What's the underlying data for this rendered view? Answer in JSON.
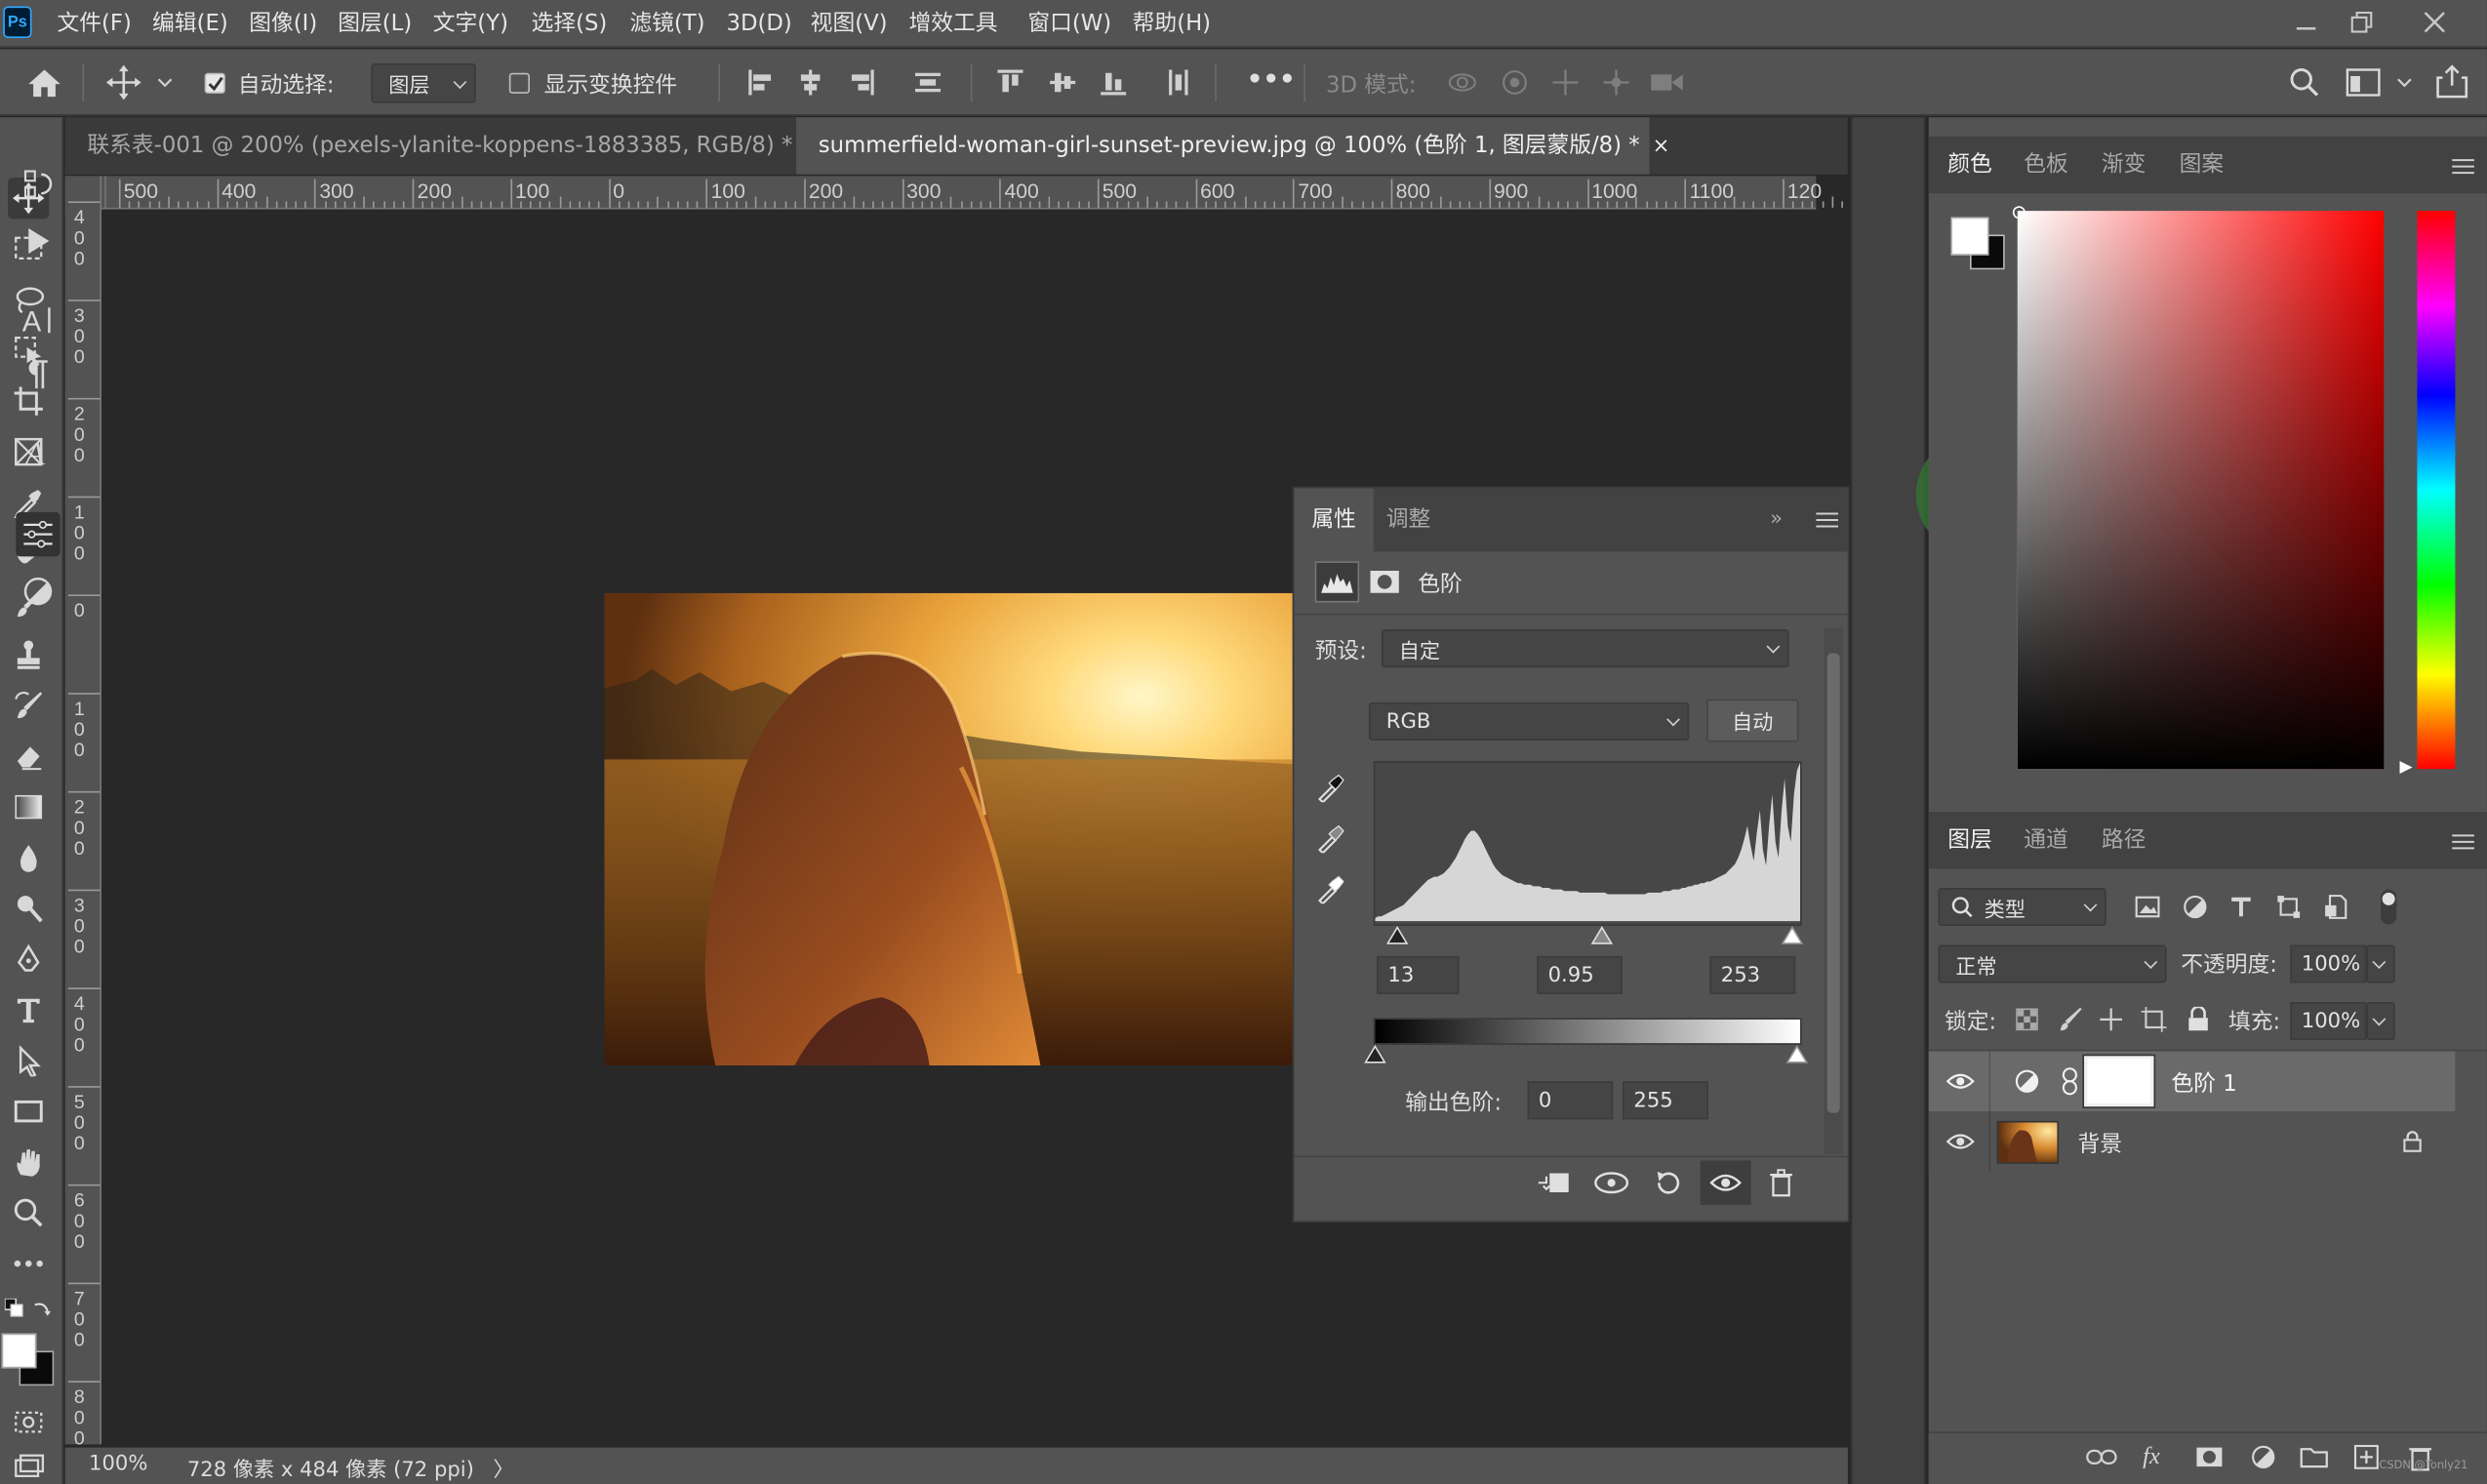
{
  "menubar": {
    "app_logo": "Ps",
    "items": [
      "文件(F)",
      "编辑(E)",
      "图像(I)",
      "图层(L)",
      "文字(Y)",
      "选择(S)",
      "滤镜(T)",
      "3D(D)",
      "视图(V)",
      "增效工具",
      "窗口(W)",
      "帮助(H)"
    ]
  },
  "options": {
    "auto_select_label": "自动选择:",
    "auto_select_checked": true,
    "auto_select_target": "图层",
    "show_transform_label": "显示变换控件",
    "show_transform_checked": false,
    "more": "•••",
    "mode_3d_label": "3D 模式:"
  },
  "tabs": [
    {
      "title": "联系表-001 @ 200% (pexels-ylanite-koppens-1883385, RGB/8) *",
      "close": "×",
      "active": false
    },
    {
      "title": "summerfield-woman-girl-sunset-preview.jpg @ 100% (色阶 1, 图层蒙版/8) *",
      "close": "×",
      "active": true
    }
  ],
  "ruler": {
    "h_labels": [
      "500",
      "400",
      "300",
      "200",
      "100",
      "0",
      "100",
      "200",
      "300",
      "400",
      "500",
      "600",
      "700",
      "800",
      "900",
      "1000",
      "1100",
      "120"
    ],
    "v_labels": [
      [
        "4",
        "0",
        "0"
      ],
      [
        "3",
        "0",
        "0"
      ],
      [
        "2",
        "0",
        "0"
      ],
      [
        "1",
        "0",
        "0"
      ],
      [
        "0"
      ],
      [
        "1",
        "0",
        "0"
      ],
      [
        "2",
        "0",
        "0"
      ],
      [
        "3",
        "0",
        "0"
      ],
      [
        "4",
        "0",
        "0"
      ],
      [
        "5",
        "0",
        "0"
      ],
      [
        "6",
        "0",
        "0"
      ],
      [
        "7",
        "0",
        "0"
      ],
      [
        "8",
        "0",
        "0"
      ]
    ]
  },
  "status": {
    "zoom": "100%",
    "doc_info": "728 像素 x 484 像素 (72 ppi)",
    "arrow": "〉"
  },
  "properties": {
    "tab_properties": "属性",
    "tab_adjust": "调整",
    "collapse": "»",
    "title": "色阶",
    "preset_label": "预设:",
    "preset_value": "自定",
    "channel": "RGB",
    "auto_button": "自动",
    "input_black": "13",
    "input_gamma": "0.95",
    "input_white": "253",
    "output_label": "输出色阶:",
    "output_black": "0",
    "output_white": "255",
    "histogram": [
      2,
      3,
      3,
      4,
      5,
      6,
      7,
      8,
      9,
      10,
      12,
      14,
      16,
      18,
      20,
      22,
      24,
      26,
      27,
      28,
      28,
      29,
      30,
      32,
      34,
      37,
      40,
      44,
      48,
      52,
      55,
      57,
      57,
      55,
      52,
      48,
      44,
      40,
      36,
      33,
      31,
      29,
      28,
      27,
      26,
      25,
      24,
      24,
      23,
      23,
      23,
      22,
      22,
      22,
      21,
      21,
      21,
      20,
      20,
      20,
      20,
      19,
      19,
      19,
      19,
      19,
      18,
      18,
      18,
      18,
      18,
      18,
      18,
      18,
      18,
      17,
      17,
      17,
      17,
      17,
      17,
      17,
      17,
      17,
      17,
      17,
      17,
      17,
      18,
      18,
      18,
      18,
      18,
      19,
      19,
      19,
      20,
      20,
      20,
      21,
      21,
      22,
      22,
      23,
      23,
      24,
      24,
      25,
      25,
      26,
      27,
      28,
      29,
      30,
      32,
      34,
      36,
      40,
      45,
      52,
      60,
      48,
      38,
      55,
      70,
      45,
      35,
      60,
      80,
      50,
      40,
      70,
      90,
      60,
      50,
      80,
      95,
      100
    ]
  },
  "color_panel": {
    "tabs": [
      "颜色",
      "色板",
      "渐变",
      "图案"
    ],
    "active_tab": "颜色",
    "hue_base": "#ff0000"
  },
  "layers_panel": {
    "tabs": [
      "图层",
      "通道",
      "路径"
    ],
    "active_tab": "图层",
    "filter_kind": "类型",
    "blend_mode": "正常",
    "opacity_label": "不透明度:",
    "opacity_value": "100%",
    "lock_label": "锁定:",
    "fill_label": "填充:",
    "fill_value": "100%",
    "layers": [
      {
        "name": "色阶 1",
        "type": "adjustment",
        "visible": true,
        "selected": true
      },
      {
        "name": "背景",
        "type": "image",
        "visible": true,
        "selected": false,
        "locked": true
      }
    ],
    "watermark": "CSDN @Tonly21"
  },
  "colors": {
    "menubar": "#535353",
    "panel": "#535353",
    "dark": "#282828",
    "accent": "#31a8ff"
  }
}
